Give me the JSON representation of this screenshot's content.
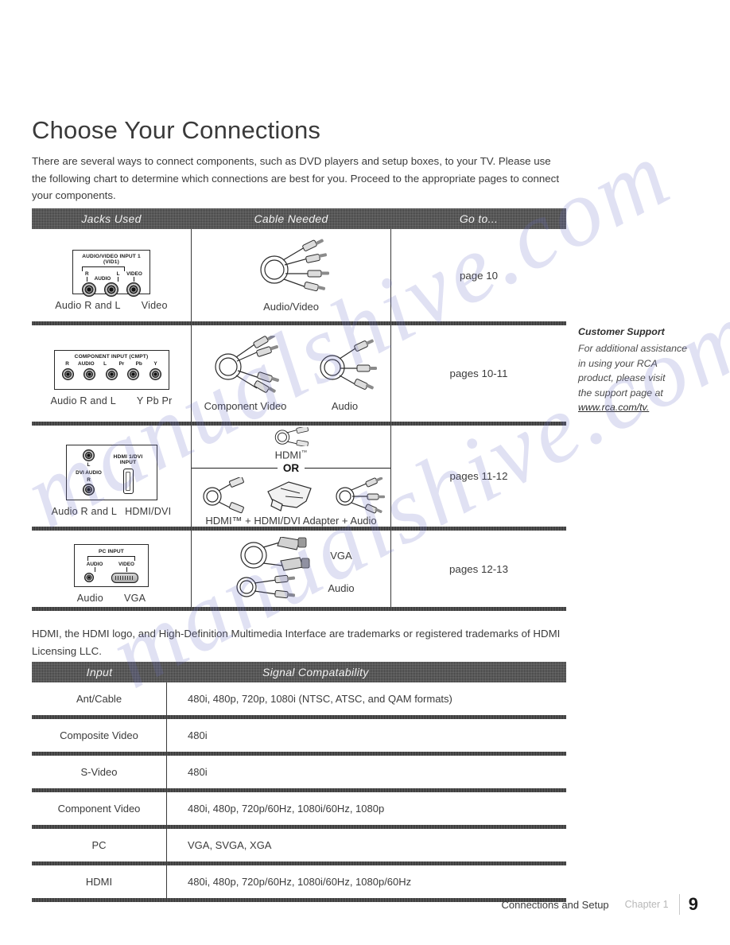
{
  "page": {
    "title": "Choose Your Connections",
    "intro": "There are several ways to connect components, such as DVD players and setup boxes, to your TV. Please use the following chart to determine which connections are best for you. Proceed to the appropriate pages to connect your components.",
    "trademark_note": "HDMI, the HDMI logo, and High-Definition Multimedia Interface are trademarks or registered trademarks of HDMI Licensing LLC.",
    "watermark_text": "manualshive.com"
  },
  "connections_table": {
    "headers": [
      "Jacks Used",
      "Cable Needed",
      "Go to..."
    ],
    "rows": [
      {
        "jack_panel": {
          "title_line1": "AUDIO/VIDEO INPUT 1",
          "title_line2": "(VID1)",
          "labels": [
            "R",
            "AUDIO",
            "L",
            "VIDEO"
          ]
        },
        "jacks_caption_left": "Audio R and L",
        "jacks_caption_right": "Video",
        "cables": [
          "Audio/Video"
        ],
        "goto": "page 10"
      },
      {
        "jack_panel": {
          "title_line1": "COMPONENT INPUT (CMPT)",
          "title_line2": "",
          "labels": [
            "R",
            "AUDIO",
            "L",
            "Pr",
            "Pb",
            "Y"
          ]
        },
        "jacks_caption_left": "Audio R and L",
        "jacks_caption_right": "Y Pb Pr",
        "cables": [
          "Component Video",
          "Audio"
        ],
        "goto": "pages 10-11"
      },
      {
        "jack_panel": {
          "title_line1": "HDMI 1/DVI INPUT",
          "title_line2": "DVI AUDIO",
          "labels": [
            "L",
            "R"
          ]
        },
        "jacks_caption_left": "Audio R and L",
        "jacks_caption_right": "HDMI/DVI",
        "cables_top": "HDMI",
        "or_label": "OR",
        "cables_bottom": "HDMI™ +  HDMI/DVI Adapter + Audio",
        "goto": "pages 11-12"
      },
      {
        "jack_panel": {
          "title_line1": "PC INPUT",
          "title_line2": "",
          "labels": [
            "AUDIO",
            "VIDEO"
          ]
        },
        "jacks_caption_left": "Audio",
        "jacks_caption_right": "VGA",
        "cables": [
          "VGA",
          "Audio"
        ],
        "goto": "pages 12-13"
      }
    ]
  },
  "signal_table": {
    "headers": [
      "Input",
      "Signal Compatability"
    ],
    "rows": [
      {
        "input": "Ant/Cable",
        "signal": "480i, 480p, 720p, 1080i (NTSC, ATSC, and QAM formats)"
      },
      {
        "input": "Composite Video",
        "signal": "480i"
      },
      {
        "input": "S-Video",
        "signal": "480i"
      },
      {
        "input": "Component  Video",
        "signal": "480i, 480p, 720p/60Hz, 1080i/60Hz, 1080p"
      },
      {
        "input": "PC",
        "signal": "VGA, SVGA, XGA"
      },
      {
        "input": "HDMI",
        "signal": "480i, 480p, 720p/60Hz, 1080i/60Hz, 1080p/60Hz"
      }
    ]
  },
  "sidebar": {
    "title": "Customer Support",
    "lines": [
      "For additional assistance",
      "in using your RCA",
      "product, please visit",
      "the support page at"
    ],
    "link": "www.rca.com/tv."
  },
  "footer": {
    "section": "Connections and Setup",
    "chapter": "Chapter 1",
    "page_number": "9"
  },
  "colors": {
    "header_bg": "#3a3a3a",
    "text": "#3b3b3b",
    "rule": "#2f2f2f",
    "watermark": "#6b6fc4"
  }
}
